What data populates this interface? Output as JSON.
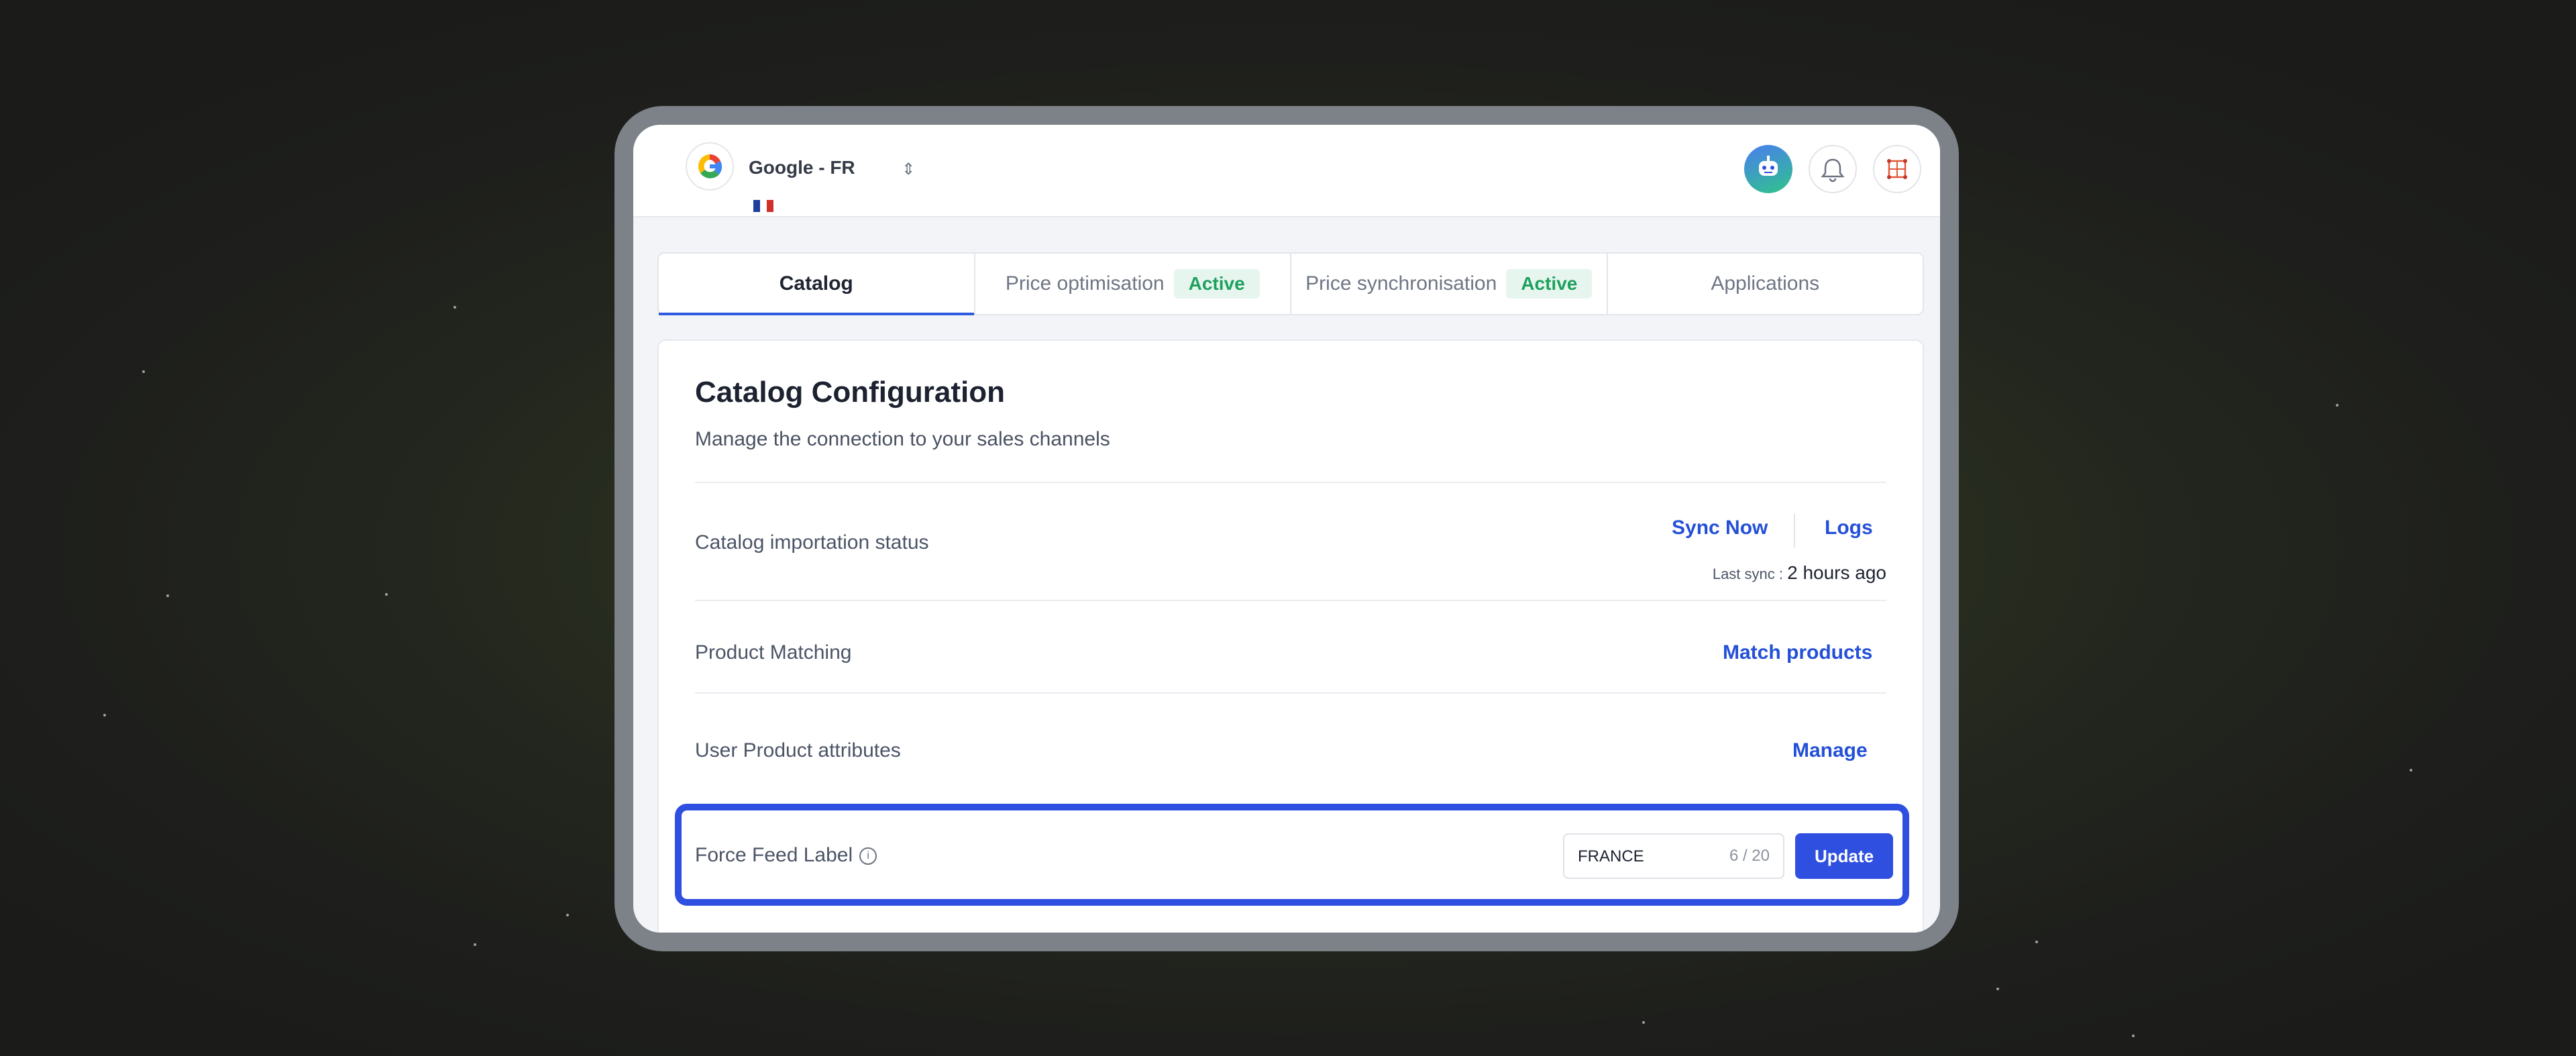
{
  "store": {
    "name": "Google - FR"
  },
  "tabs": [
    {
      "label": "Catalog",
      "active": true,
      "badge": ""
    },
    {
      "label": "Price optimisation",
      "active": false,
      "badge": "Active"
    },
    {
      "label": "Price synchronisation",
      "active": false,
      "badge": "Active"
    },
    {
      "label": "Applications",
      "active": false,
      "badge": ""
    }
  ],
  "config": {
    "title": "Catalog Configuration",
    "subtitle": "Manage the connection to your sales channels",
    "rows": {
      "import_status": {
        "label": "Catalog importation status",
        "sync_now": "Sync Now",
        "logs": "Logs",
        "last_sync_label": "Last sync :",
        "last_sync_value": "2 hours ago"
      },
      "matching": {
        "label": "Product Matching",
        "action": "Match products"
      },
      "attributes": {
        "label": "User Product attributes",
        "action": "Manage"
      },
      "feed_label": {
        "label": "Force Feed Label",
        "value": "FRANCE",
        "counter": "6 / 20",
        "button": "Update"
      }
    }
  },
  "colors": {
    "accent": "#2f4fe0",
    "link": "#2450d8",
    "badge_text": "#1fa05f",
    "badge_bg": "#e6f6ee"
  },
  "icons": {
    "store_logo": "google-logo-icon",
    "flag": "france-flag-icon",
    "chevron": "chevron-up-down-icon",
    "assistant": "robot-assistant-icon",
    "notifications": "bell-icon",
    "apps": "grid-apps-icon",
    "info": "info-icon"
  }
}
